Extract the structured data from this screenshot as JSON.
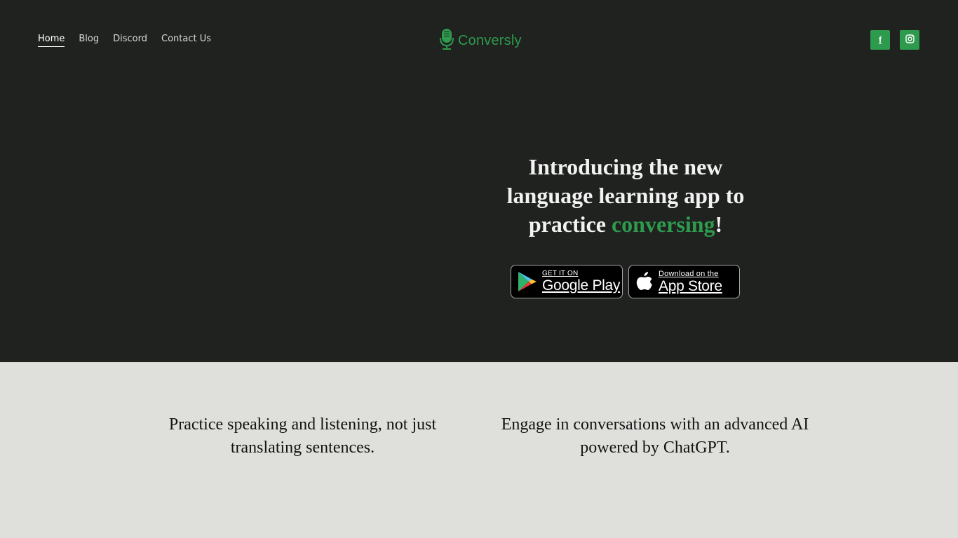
{
  "nav": {
    "items": [
      {
        "label": "Home",
        "active": true
      },
      {
        "label": "Blog",
        "active": false
      },
      {
        "label": "Discord",
        "active": false
      },
      {
        "label": "Contact Us",
        "active": false
      }
    ]
  },
  "logo": {
    "text": "Conversly",
    "icon": "microphone-icon"
  },
  "social": {
    "facebook": {
      "label": "f",
      "icon": "facebook-icon"
    },
    "instagram": {
      "icon": "instagram-icon"
    }
  },
  "hero": {
    "headline_pre": "Introducing the new language learning app to practice ",
    "headline_accent": "conversing",
    "headline_post": "!"
  },
  "stores": {
    "google_play": {
      "small": "GET IT ON",
      "big": "Google Play",
      "icon": "google-play-icon"
    },
    "app_store": {
      "small": "Download on the",
      "big": "App Store",
      "icon": "apple-icon"
    }
  },
  "features": [
    {
      "text": "Practice speaking and listening, not just translating sentences."
    },
    {
      "text": "Engage in conversations with an advanced AI powered by ChatGPT."
    }
  ],
  "colors": {
    "hero_bg": "#1f221f",
    "accent": "#2e9a4e",
    "section_bg": "#dfdfdb"
  }
}
